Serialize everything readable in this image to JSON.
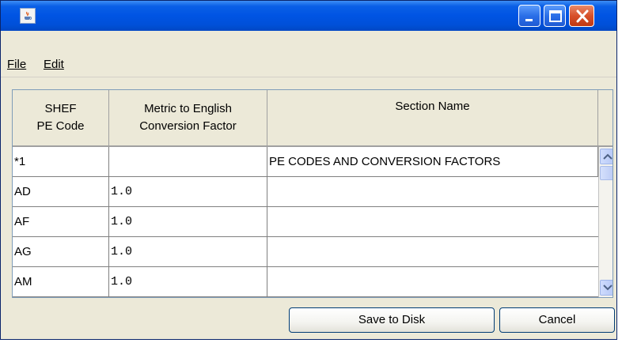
{
  "window": {
    "title": "",
    "icon": "java-cup-icon",
    "controls": [
      "minimize-icon",
      "maximize-icon",
      "close-icon"
    ]
  },
  "menu": {
    "file": "File",
    "edit": "Edit"
  },
  "table": {
    "headers": {
      "pe_code_line1": "SHEF",
      "pe_code_line2": "PE Code",
      "factor_line1": "Metric to English",
      "factor_line2": "Conversion Factor",
      "section": "Section Name"
    },
    "rows": [
      {
        "pe_code": "*1",
        "factor": "",
        "section": "PE CODES AND CONVERSION FACTORS"
      },
      {
        "pe_code": "AD",
        "factor": "1.0",
        "section": ""
      },
      {
        "pe_code": "AF",
        "factor": "1.0",
        "section": ""
      },
      {
        "pe_code": "AG",
        "factor": "1.0",
        "section": ""
      },
      {
        "pe_code": "AM",
        "factor": "1.0",
        "section": ""
      }
    ]
  },
  "buttons": {
    "save": "Save to Disk",
    "cancel": "Cancel"
  },
  "colors": {
    "titlebar": "#0054e3",
    "background": "#ece9d8",
    "close_button": "#d8502a"
  }
}
